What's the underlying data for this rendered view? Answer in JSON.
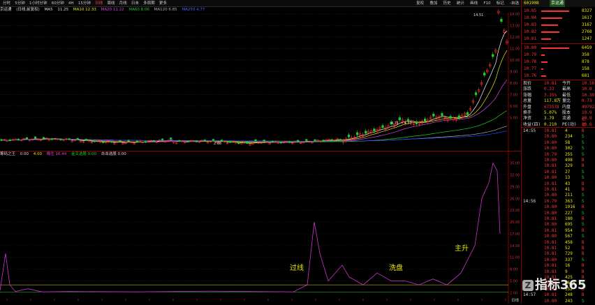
{
  "toolbar": {
    "periods": [
      "分时",
      "5分钟",
      "1小时分钟",
      "60分钟",
      "4H",
      "15分钟",
      "日线",
      "周线",
      "月线",
      "日未",
      "多周期",
      "更多"
    ],
    "active_period": "日线",
    "tools": [
      "复权",
      "叠加",
      "历史",
      "统计",
      "画线",
      "F10",
      "标记",
      "-自选"
    ]
  },
  "legend_main": {
    "name": "京运通",
    "mode": "(日线,前复权)",
    "ma_label": "MA5",
    "ma5": "11.25",
    "ma10": "MA10 12.33",
    "ma20": "MA20 11.22",
    "ma60": "MA60 8.06",
    "ma120": "MA120 6.85",
    "ma250": "MA250 4.77"
  },
  "legend_ind": {
    "name": "筹码之王",
    "v1": "0.00",
    "v2": "4.00",
    "v3": "橡生 16.44",
    "v4": "金叉选股 0.00",
    "v5": "击击选股 0.00"
  },
  "main_axis": [
    "14.00",
    "13.00",
    "12.00",
    "11.00",
    "10.00",
    "9.00",
    "8.00",
    "7.00",
    "6.00",
    "5.00"
  ],
  "ind_axis": [
    "35.00",
    "32.00",
    "29.00",
    "26.00",
    "23.00",
    "20.00",
    "17.00",
    "14.00",
    "11.00",
    "8.00",
    "5.00",
    "2.00"
  ],
  "main_annotations": {
    "high": "14.51",
    "mid": "4.71 ~ 4.77",
    "low": "2.68"
  },
  "ind_annotations": {
    "line_cross": "过线",
    "wash": "洗盘",
    "rise": "主升"
  },
  "quote": {
    "code": "601908",
    "name": "京运通",
    "asks": [
      {
        "label": "卖五",
        "price": "10.85",
        "vol": "8327"
      },
      {
        "label": "卖四",
        "price": "10.84",
        "vol": "1617"
      },
      {
        "label": "卖三",
        "price": "10.83",
        "vol": "3167"
      },
      {
        "label": "卖二",
        "price": "10.82",
        "vol": "2768"
      },
      {
        "label": "卖一",
        "price": "10.81",
        "vol": "1247"
      }
    ],
    "bids": [
      {
        "label": "买一",
        "price": "10.80",
        "vol": "6459"
      },
      {
        "label": "买二",
        "price": "10.79",
        "vol": "358"
      },
      {
        "label": "买三",
        "price": "10.78",
        "vol": "878"
      },
      {
        "label": "买四",
        "price": "10.77",
        "vol": "158"
      },
      {
        "label": "买五",
        "price": "10.76",
        "vol": "681"
      }
    ],
    "stats": [
      {
        "l1": "现价",
        "v1": "10.81",
        "l2": "今开",
        "v2": "10.58"
      },
      {
        "l1": "涨跌",
        "v1": "0.33",
        "l2": "最高",
        "v2": "10.8"
      },
      {
        "l1": "涨幅",
        "v1": "3.15%",
        "l2": "最低",
        "v2": "10.39"
      },
      {
        "l1": "总量",
        "v1": "117.8万",
        "l2": "量比",
        "v2": "0.73"
      },
      {
        "l1": "外盘",
        "v1": "673578",
        "l2": "内盘",
        "v2": "497923"
      },
      {
        "l1": "换手",
        "v1": "5.07%",
        "l2": "股本",
        "v2": "19.9亿"
      },
      {
        "l1": "净资",
        "v1": "3.79",
        "l2": "流通",
        "v2": "19.9亿"
      },
      {
        "l1": "收益(四)",
        "v1": "0.210",
        "l2": "PE(动)",
        "v2": "38.6"
      }
    ],
    "ticks": [
      {
        "t": "14:55",
        "p": "10.81",
        "v": "4",
        "d": "B"
      },
      {
        "t": "",
        "p": "10.80",
        "v": "234",
        "d": "S"
      },
      {
        "t": "",
        "p": "10.80",
        "v": "58",
        "d": "S"
      },
      {
        "t": "",
        "p": "10.80",
        "v": "302",
        "d": "S"
      },
      {
        "t": "",
        "p": "10.79",
        "v": "255",
        "d": "S"
      },
      {
        "t": "",
        "p": "10.80",
        "v": "498",
        "d": "B"
      },
      {
        "t": "",
        "p": "10.81",
        "v": "329",
        "d": "B"
      },
      {
        "t": "",
        "p": "10.81",
        "v": "27",
        "d": "S"
      },
      {
        "t": "",
        "p": "10.80",
        "v": "13",
        "d": "S"
      },
      {
        "t": "",
        "p": "10.81",
        "v": "43",
        "d": "B"
      },
      {
        "t": "",
        "p": "10.81",
        "v": "41",
        "d": "B"
      },
      {
        "t": "",
        "p": "10.80",
        "v": "211",
        "d": "S"
      },
      {
        "t": "14:56",
        "p": "10.79",
        "v": "363",
        "d": "S"
      },
      {
        "t": "",
        "p": "10.80",
        "v": "1916",
        "d": "B"
      },
      {
        "t": "",
        "p": "10.80",
        "v": "227",
        "d": "S"
      },
      {
        "t": "",
        "p": "10.81",
        "v": "180",
        "d": "B"
      },
      {
        "t": "",
        "p": "10.80",
        "v": "695",
        "d": "S"
      },
      {
        "t": "",
        "p": "10.81",
        "v": "954",
        "d": "B"
      },
      {
        "t": "",
        "p": "10.80",
        "v": "567",
        "d": "S"
      },
      {
        "t": "",
        "p": "10.81",
        "v": "458",
        "d": "B"
      },
      {
        "t": "",
        "p": "10.81",
        "v": "52",
        "d": "B"
      },
      {
        "t": "",
        "p": "10.81",
        "v": "729",
        "d": "B"
      },
      {
        "t": "",
        "p": "10.80",
        "v": "337",
        "d": "S"
      },
      {
        "t": "",
        "p": "10.81",
        "v": "16",
        "d": "B"
      },
      {
        "t": "",
        "p": "10.81",
        "v": "9",
        "d": "B"
      },
      {
        "t": "",
        "p": "10.81",
        "v": "425",
        "d": "B"
      },
      {
        "t": "",
        "p": "10.80",
        "v": "1618",
        "d": "S"
      },
      {
        "t": "",
        "p": "10.81",
        "v": "152",
        "d": "B"
      },
      {
        "t": "14:57",
        "p": "10.81",
        "v": "248",
        "d": "B"
      },
      {
        "t": "",
        "p": "10.80",
        "v": "243",
        "d": "S"
      }
    ]
  },
  "watermark": "指标365",
  "bottom_tab": "日线",
  "colors": {
    "up": "#ff3333",
    "down": "#22cc22",
    "ma5": "#ffffff",
    "ma10": "#e8e800",
    "ma20": "#e040e0",
    "ma60": "#22cc22",
    "ma120": "#aaaaaa",
    "ma250": "#2244ff",
    "indicator": "#cc33cc"
  }
}
